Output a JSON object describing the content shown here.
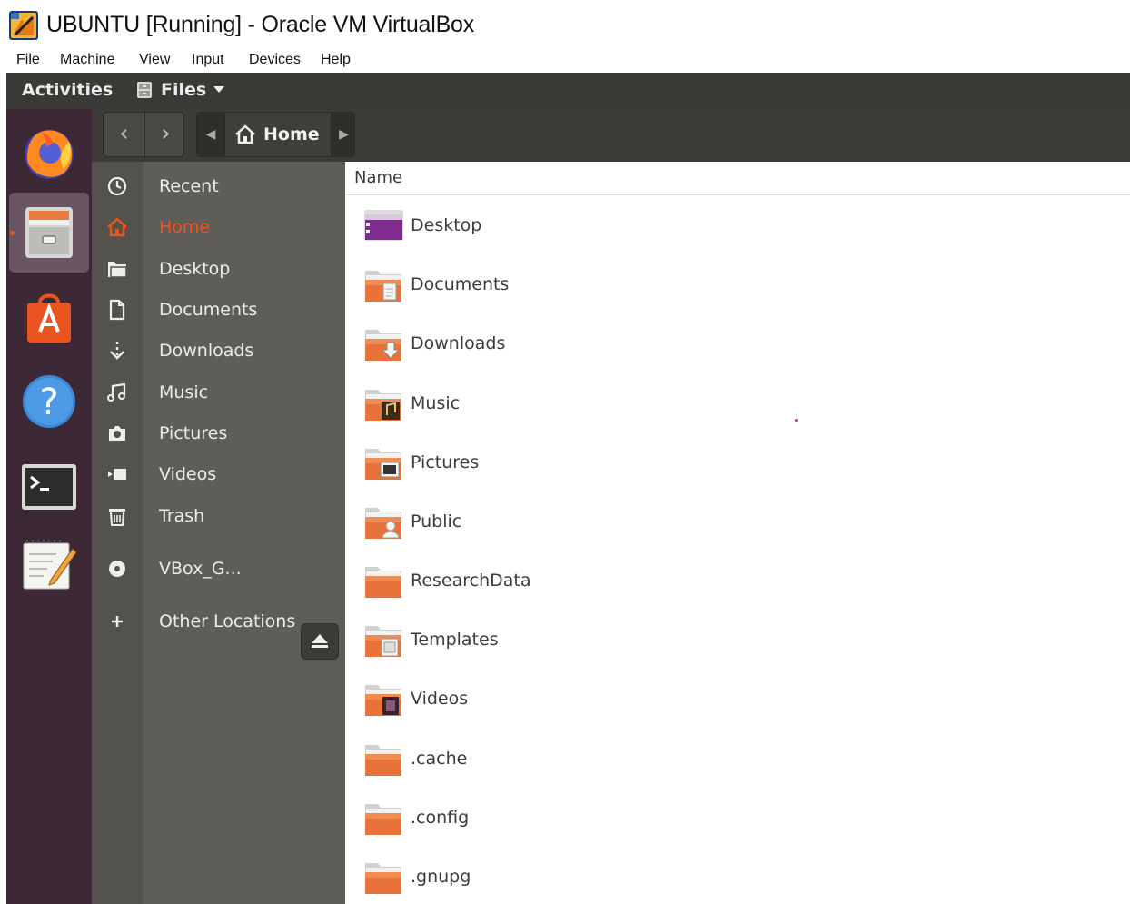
{
  "window": {
    "title": "UBUNTU [Running] - Oracle VM VirtualBox",
    "menu": [
      "File",
      "Machine",
      "View",
      "Input",
      "Devices",
      "Help"
    ]
  },
  "topbar": {
    "activities": "Activities",
    "app_menu": "Files"
  },
  "dock": {
    "apps": [
      {
        "name": "firefox-icon",
        "active": false
      },
      {
        "name": "files-icon",
        "active": true
      },
      {
        "name": "software-center-icon",
        "active": false
      },
      {
        "name": "help-icon",
        "active": false
      },
      {
        "name": "terminal-icon",
        "active": false
      },
      {
        "name": "text-editor-icon",
        "active": false
      }
    ]
  },
  "header": {
    "back_glyph": "‹",
    "forward_glyph": "›",
    "location": "Home"
  },
  "sidebar": {
    "items": [
      {
        "label": "Recent",
        "icon": "clock-icon"
      },
      {
        "label": "Home",
        "icon": "home-icon",
        "active": true
      },
      {
        "label": "Desktop",
        "icon": "folder-icon"
      },
      {
        "label": "Documents",
        "icon": "document-icon"
      },
      {
        "label": "Downloads",
        "icon": "download-icon"
      },
      {
        "label": "Music",
        "icon": "music-icon"
      },
      {
        "label": "Pictures",
        "icon": "camera-icon"
      },
      {
        "label": "Videos",
        "icon": "video-icon"
      },
      {
        "label": "Trash",
        "icon": "trash-icon"
      }
    ],
    "device": {
      "label": "VBox_G...",
      "icon": "disc-icon"
    },
    "other": {
      "label": "Other Locations",
      "icon": "plus-icon"
    }
  },
  "content": {
    "column_name": "Name",
    "files": [
      {
        "name": "Desktop",
        "icon": "desktop-folder-icon"
      },
      {
        "name": "Documents",
        "icon": "documents-folder-icon"
      },
      {
        "name": "Downloads",
        "icon": "downloads-folder-icon"
      },
      {
        "name": "Music",
        "icon": "music-folder-icon"
      },
      {
        "name": "Pictures",
        "icon": "pictures-folder-icon"
      },
      {
        "name": "Public",
        "icon": "public-folder-icon"
      },
      {
        "name": "ResearchData",
        "icon": "folder-icon"
      },
      {
        "name": "Templates",
        "icon": "templates-folder-icon"
      },
      {
        "name": "Videos",
        "icon": "videos-folder-icon"
      },
      {
        "name": ".cache",
        "icon": "folder-icon"
      },
      {
        "name": ".config",
        "icon": "folder-icon"
      },
      {
        "name": ".gnupg",
        "icon": "folder-icon"
      }
    ]
  },
  "colors": {
    "accent": "#e95420",
    "topbar": "#3a3936",
    "dock": "#3d2936",
    "sidebar": "#5e5d57",
    "folder": "#e7733a"
  }
}
